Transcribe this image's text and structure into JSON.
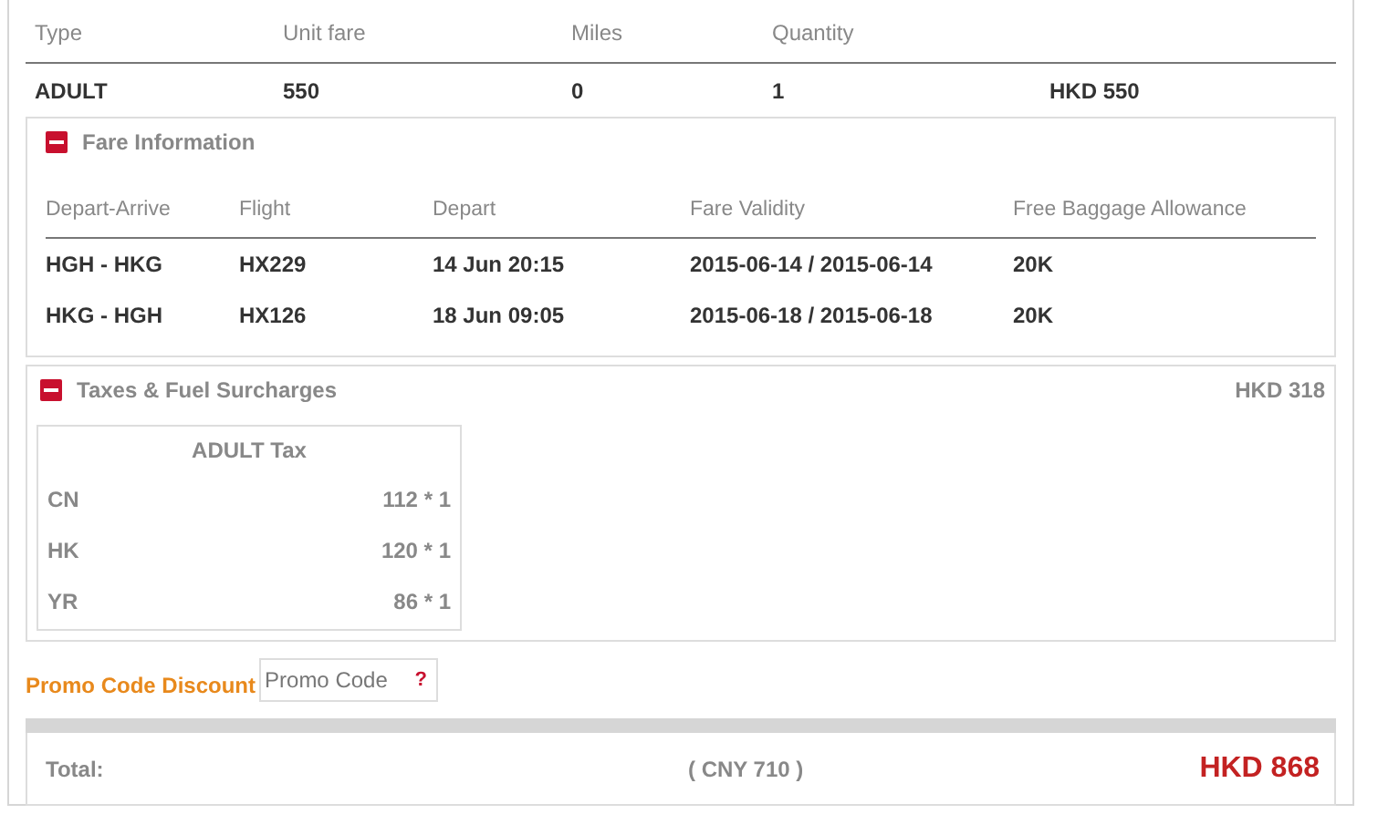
{
  "summary": {
    "columns": [
      "Type",
      "Unit fare",
      "Miles",
      "Quantity"
    ],
    "row": {
      "type": "ADULT",
      "unit_fare": "550",
      "miles": "0",
      "quantity": "1",
      "total": "HKD 550"
    }
  },
  "fare_information": {
    "title": "Fare Information",
    "expanded": true,
    "columns": [
      "Depart-Arrive",
      "Flight",
      "Depart",
      "Fare Validity",
      "Free Baggage Allowance"
    ],
    "rows": [
      [
        "HGH - HKG",
        "HX229",
        "14 Jun 20:15",
        "2015-06-14 / 2015-06-14",
        "20K"
      ],
      [
        "HKG - HGH",
        "HX126",
        "18 Jun 09:05",
        "2015-06-18 / 2015-06-18",
        "20K"
      ]
    ]
  },
  "taxes": {
    "title": "Taxes & Fuel Surcharges",
    "expanded": true,
    "amount": "HKD 318",
    "table_title": "ADULT Tax",
    "rows": [
      {
        "code": "CN",
        "amount": "112 * 1"
      },
      {
        "code": "HK",
        "amount": "120 * 1"
      },
      {
        "code": "YR",
        "amount": "86 * 1"
      }
    ]
  },
  "promo": {
    "label": "Promo Code Discount",
    "placeholder": "Promo Code",
    "help": "?"
  },
  "total": {
    "label": "Total:",
    "converted": "( CNY 710 )",
    "amount": "HKD 868"
  }
}
